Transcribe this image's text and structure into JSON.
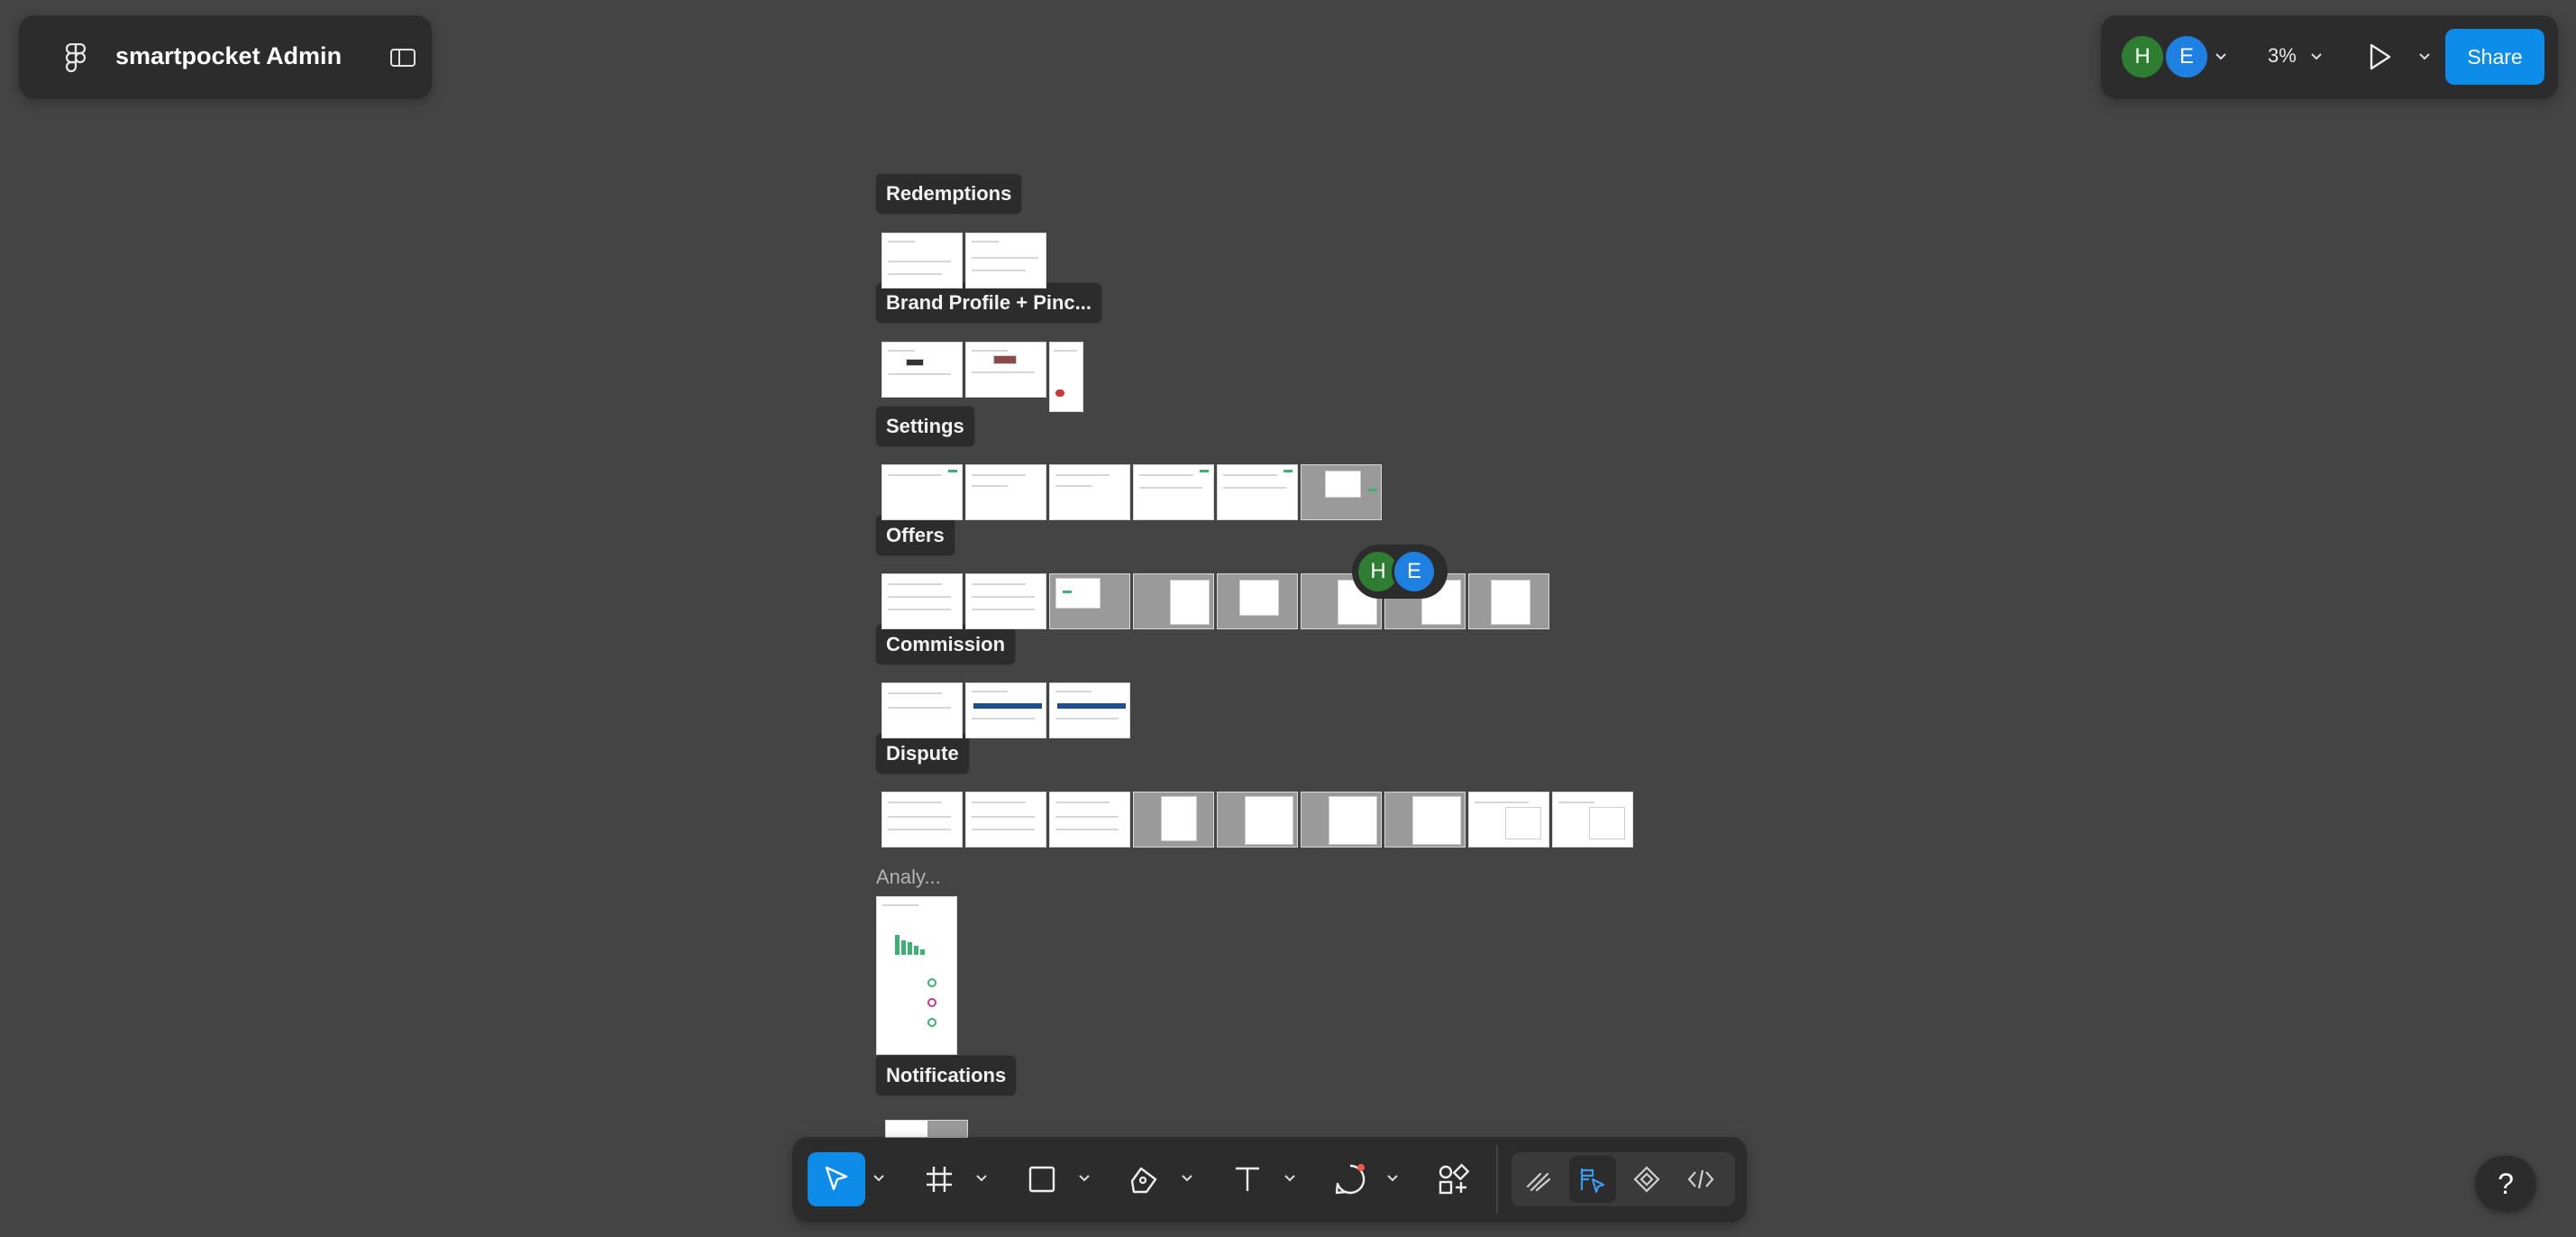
{
  "file": {
    "name": "smartpocket Admin",
    "logo_icon": "figma-logo-icon",
    "sidebar_toggle_icon": "sidebar-toggle-icon"
  },
  "header": {
    "collaborators": [
      {
        "initial": "H",
        "color": "#2e7d32"
      },
      {
        "initial": "E",
        "color": "#1e80e0"
      }
    ],
    "zoom": "3%",
    "present_icon": "play-icon",
    "share_label": "Share",
    "accent": "#0d8ce9"
  },
  "canvas": {
    "sections": [
      {
        "label": "Redemptions",
        "frames": 2
      },
      {
        "label": "Brand Profile + Pinc...",
        "frames": 3
      },
      {
        "label": "Settings",
        "frames": 6
      },
      {
        "label": "Offers",
        "frames": 8
      },
      {
        "label": "Commission",
        "frames": 3
      },
      {
        "label": "Dispute",
        "frames": 9
      },
      {
        "label": "Analy...",
        "frames": 1
      },
      {
        "label": "Notifications",
        "frames": 1
      }
    ],
    "cursor_collaborators": [
      "H",
      "E"
    ]
  },
  "toolbar": {
    "tools": [
      {
        "name": "move-tool",
        "icon": "cursor-icon",
        "active": true
      },
      {
        "name": "frame-tool",
        "icon": "frame-icon"
      },
      {
        "name": "rectangle-tool",
        "icon": "rectangle-icon"
      },
      {
        "name": "pen-tool",
        "icon": "pen-icon"
      },
      {
        "name": "text-tool",
        "icon": "text-icon",
        "glyph": "T"
      },
      {
        "name": "comment-tool",
        "icon": "comment-icon"
      },
      {
        "name": "actions-tool",
        "icon": "actions-icon"
      }
    ],
    "modes": [
      {
        "name": "draw-mode",
        "icon": "draw-icon"
      },
      {
        "name": "design-mode",
        "icon": "design-icon",
        "active": true
      },
      {
        "name": "components-mode",
        "icon": "components-icon"
      },
      {
        "name": "dev-mode",
        "icon": "code-icon"
      }
    ]
  },
  "help": {
    "label": "?"
  }
}
